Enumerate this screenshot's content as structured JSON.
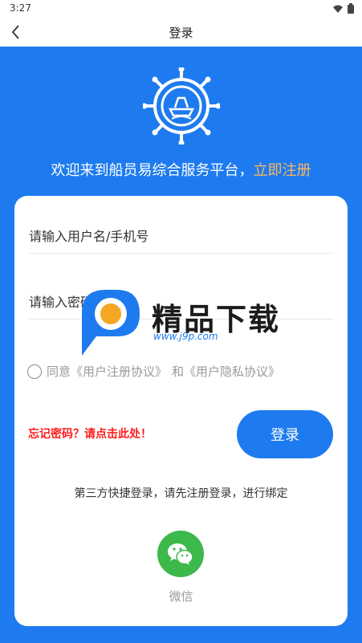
{
  "status": {
    "time": "3:27"
  },
  "header": {
    "title": "登录"
  },
  "welcome": {
    "text": "欢迎来到船员易综合服务平台，",
    "register_link": "立即注册"
  },
  "form": {
    "username_placeholder": "请输入用户名/手机号",
    "password_placeholder": "请输入密码",
    "agree_prefix": "同意",
    "user_agreement": "《用户注册协议》",
    "agree_and": "和",
    "privacy_agreement": "《用户隐私协议》",
    "forgot_text": "忘记密码？请点击此处！",
    "login_label": "登录"
  },
  "third_party": {
    "text": "第三方快捷登录，请先注册登录，进行绑定",
    "wechat_label": "微信"
  },
  "watermark": {
    "text": "精品下载",
    "url": "www.j9p.com"
  },
  "colors": {
    "primary": "#1e7bef",
    "register_link": "#ffb65a",
    "forgot": "#ff1a1a",
    "wechat": "#3db84b"
  }
}
